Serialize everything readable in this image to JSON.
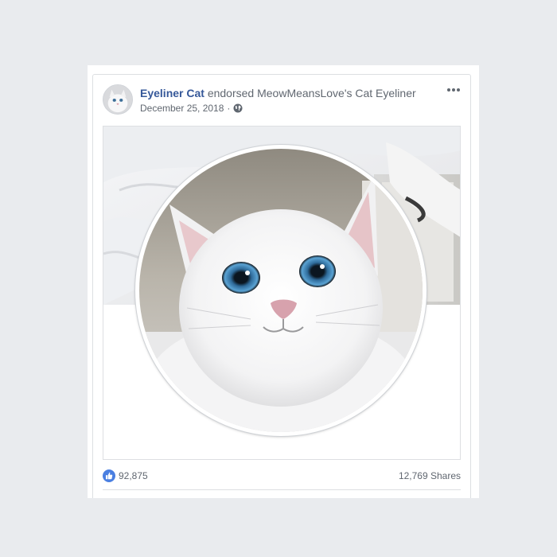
{
  "post": {
    "author": "Eyeliner Cat",
    "action": "endorsed MeowMeansLove's Cat Eyeliner",
    "date": "December 25, 2018",
    "date_separator": "·",
    "privacy_icon": "globe-icon",
    "more_icon": "more-options-icon"
  },
  "stats": {
    "likes": "92,875",
    "like_icon": "thumbs-up-icon",
    "shares": "12,769 Shares"
  },
  "colors": {
    "author_link": "#365899",
    "secondary_text": "#606770",
    "like_badge": "#4a7fe1",
    "page_background": "#e9ebee"
  }
}
